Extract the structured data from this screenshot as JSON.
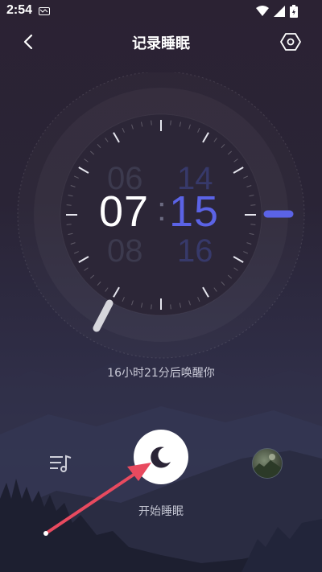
{
  "status_bar": {
    "time": "2:54",
    "icons": [
      "notification-icon",
      "wifi-icon",
      "signal-icon",
      "battery-icon"
    ]
  },
  "header": {
    "title": "记录睡眠",
    "back_icon": "chevron-left-icon",
    "settings_icon": "settings-hexagon-icon"
  },
  "alarm": {
    "hour": "07",
    "minute": "15",
    "separator": ":",
    "hour_above": "06",
    "hour_below": "08",
    "minute_above": "14",
    "minute_below": "16",
    "wake_text": "16小时21分后唤醒你"
  },
  "actions": {
    "music_icon": "music-list-icon",
    "start_icon": "moon-icon",
    "start_label": "开始睡眠",
    "avatar_icon": "avatar"
  },
  "colors": {
    "accent": "#5b63e6",
    "background": "#2a2436",
    "annotation_arrow": "#e84a5f"
  }
}
